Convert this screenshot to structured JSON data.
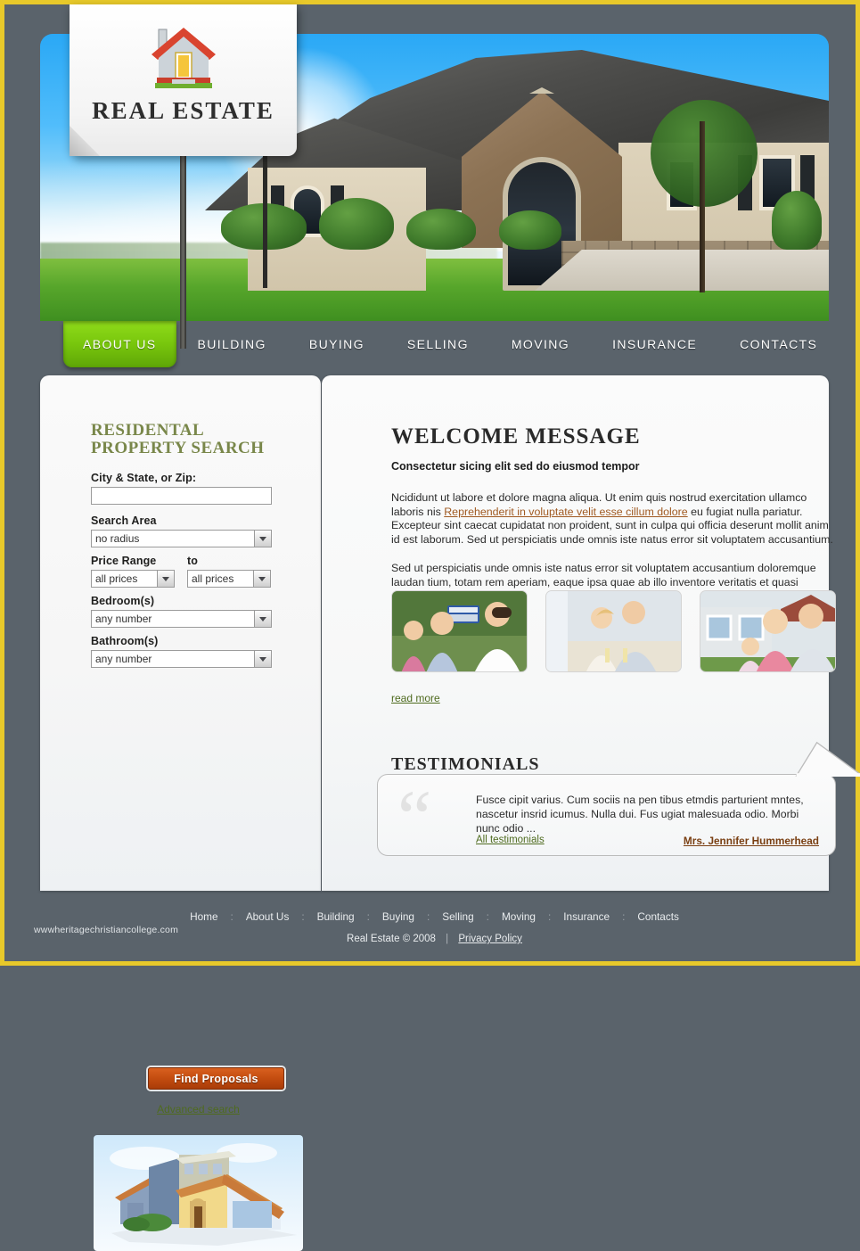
{
  "theme": {
    "frame_border": "#e8c92a",
    "page_bg": "#5a636b",
    "accent_green": "#79c70d",
    "accent_orange": "#c44d10",
    "heading_olive": "#79874a",
    "link_green": "#4f6b1f",
    "link_orange": "#a05a22"
  },
  "logo": {
    "text": "REAL  ESTATE",
    "icon": "house-icon"
  },
  "nav": {
    "items": [
      {
        "label": "ABOUT  US",
        "active": true
      },
      {
        "label": "BUILDING",
        "active": false
      },
      {
        "label": "BUYING",
        "active": false
      },
      {
        "label": "SELLING",
        "active": false
      },
      {
        "label": "MOVING",
        "active": false
      },
      {
        "label": "INSURANCE",
        "active": false
      },
      {
        "label": "CONTACTS",
        "active": false
      }
    ]
  },
  "sidebar": {
    "title": "RESIDENTAL PROPERTY SEARCH",
    "fields": {
      "city_label": "City & State, or Zip:",
      "city_value": "",
      "city_placeholder": "",
      "area_label": "Search Area",
      "area_value": "no radius",
      "price_label": "Price Range",
      "price_to_label": "to",
      "price_from_value": "all prices",
      "price_to_value": "all prices",
      "bedrooms_label": "Bedroom(s)",
      "bedrooms_value": "any number",
      "bathrooms_label": "Bathroom(s)",
      "bathrooms_value": "any number"
    },
    "find_button": "Find Proposals",
    "advanced_link": "Advanced search",
    "illustration": "house-illustration"
  },
  "main": {
    "heading": "WELCOME  MESSAGE",
    "subheading": "Consectetur sicing elit sed do eiusmod tempor",
    "paragraph1_a": "Ncididunt ut labore et dolore magna aliqua. Ut enim quis nostrud  exercitation ullamco laboris nis ",
    "paragraph1_link": "Reprehenderit in voluptate velit esse cillum dolore",
    "paragraph1_b": " eu fugiat nulla pariatur. Excepteur sint caecat cupidatat non proident, sunt in culpa qui officia deserunt mollit anim id est laborum. Sed ut perspiciatis unde omnis iste natus error sit voluptatem accusantium.",
    "paragraph2": "Sed ut perspiciatis unde omnis iste natus error sit voluptatem accusantium doloremque laudan tium, totam rem aperiam, eaque ipsa quae ab illo inventore veritatis et quasi architecto.",
    "thumbnails": [
      {
        "name": "agent-handing-keys-to-couple-photo"
      },
      {
        "name": "couple-toasting-with-wine-photo"
      },
      {
        "name": "family-in-front-of-house-photo"
      }
    ],
    "read_more": "read more",
    "testimonials_heading": "TESTIMONIALS",
    "testimonial_quote": "Fusce cipit varius. Cum sociis na pen tibus etmdis parturient mntes, nascetur insrid icumus. Nulla dui. Fus ugiat malesuada odio. Morbi nunc odio ...",
    "all_testimonials": "All testimonials ",
    "testimonial_author": "Mrs. Jennifer Hummerhead"
  },
  "footer": {
    "links": [
      "Home",
      "About Us",
      "Building",
      "Buying",
      "Selling",
      "Moving",
      "Insurance",
      "Contacts"
    ],
    "separator": ":",
    "site_url": "wwwheritagechristiancollege.com",
    "copyright": "Real Estate © 2008",
    "bar": "|",
    "privacy": "Privacy Policy"
  }
}
